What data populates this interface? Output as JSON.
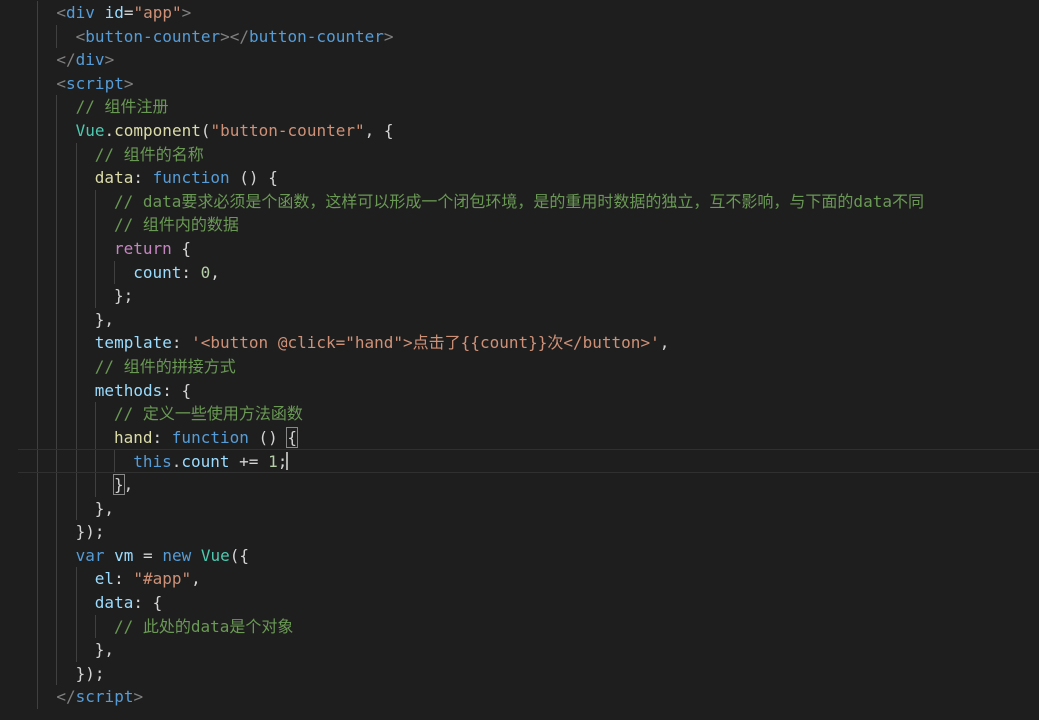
{
  "editor": {
    "language": "html",
    "theme_colors": {
      "background": "#1e1e1e",
      "tag": "#569cd6",
      "attribute": "#9cdcfe",
      "string": "#ce9178",
      "comment": "#6a9955",
      "keyword": "#569cd6",
      "control": "#c586c0",
      "function": "#dcdcaa",
      "class": "#4ec9b0",
      "number": "#b5cea8",
      "text": "#d4d4d4"
    },
    "current_line": 19,
    "lines": [
      {
        "indent": 2,
        "tokens": [
          [
            "t-punct",
            "<"
          ],
          [
            "t-tag",
            "div"
          ],
          [
            "t-text",
            " "
          ],
          [
            "t-attr",
            "id"
          ],
          [
            "t-text",
            "="
          ],
          [
            "t-str",
            "\"app\""
          ],
          [
            "t-punct",
            ">"
          ]
        ]
      },
      {
        "indent": 3,
        "tokens": [
          [
            "t-punct",
            "<"
          ],
          [
            "t-tag",
            "button-counter"
          ],
          [
            "t-punct",
            "></"
          ],
          [
            "t-tag",
            "button-counter"
          ],
          [
            "t-punct",
            ">"
          ]
        ]
      },
      {
        "indent": 2,
        "tokens": [
          [
            "t-punct",
            "</"
          ],
          [
            "t-tag",
            "div"
          ],
          [
            "t-punct",
            ">"
          ]
        ]
      },
      {
        "indent": 2,
        "tokens": [
          [
            "t-punct",
            "<"
          ],
          [
            "t-tag",
            "script"
          ],
          [
            "t-punct",
            ">"
          ]
        ]
      },
      {
        "indent": 3,
        "tokens": [
          [
            "t-cmt",
            "// 组件注册"
          ]
        ]
      },
      {
        "indent": 3,
        "tokens": [
          [
            "t-cls",
            "Vue"
          ],
          [
            "t-text",
            "."
          ],
          [
            "t-fn",
            "component"
          ],
          [
            "t-text",
            "("
          ],
          [
            "t-str",
            "\"button-counter\""
          ],
          [
            "t-text",
            ", {"
          ]
        ]
      },
      {
        "indent": 4,
        "tokens": [
          [
            "t-cmt",
            "// 组件的名称"
          ]
        ]
      },
      {
        "indent": 4,
        "tokens": [
          [
            "t-fn",
            "data"
          ],
          [
            "t-text",
            ": "
          ],
          [
            "t-kw",
            "function"
          ],
          [
            "t-text",
            " () {"
          ]
        ]
      },
      {
        "indent": 5,
        "tokens": [
          [
            "t-cmt",
            "// data要求必须是个函数，这样可以形成一个闭包环境，是的重用时数据的独立，互不影响，与下面的data不同"
          ]
        ]
      },
      {
        "indent": 5,
        "tokens": [
          [
            "t-cmt",
            "// 组件内的数据"
          ]
        ]
      },
      {
        "indent": 5,
        "tokens": [
          [
            "t-ctrl",
            "return"
          ],
          [
            "t-text",
            " {"
          ]
        ]
      },
      {
        "indent": 6,
        "tokens": [
          [
            "t-prop",
            "count"
          ],
          [
            "t-text",
            ": "
          ],
          [
            "t-num",
            "0"
          ],
          [
            "t-text",
            ","
          ]
        ]
      },
      {
        "indent": 5,
        "tokens": [
          [
            "t-text",
            "};"
          ]
        ]
      },
      {
        "indent": 4,
        "tokens": [
          [
            "t-text",
            "},"
          ]
        ]
      },
      {
        "indent": 4,
        "tokens": [
          [
            "t-prop",
            "template"
          ],
          [
            "t-text",
            ": "
          ],
          [
            "t-str",
            "'<button @click=\"hand\">点击了{{count}}次</button>'"
          ],
          [
            "t-text",
            ","
          ]
        ]
      },
      {
        "indent": 4,
        "tokens": [
          [
            "t-cmt",
            "// 组件的拼接方式"
          ]
        ]
      },
      {
        "indent": 4,
        "tokens": [
          [
            "t-prop",
            "methods"
          ],
          [
            "t-text",
            ": {"
          ]
        ]
      },
      {
        "indent": 5,
        "tokens": [
          [
            "t-cmt",
            "// 定义一些使用方法函数"
          ]
        ]
      },
      {
        "indent": 5,
        "tokens": [
          [
            "t-fn",
            "hand"
          ],
          [
            "t-text",
            ": "
          ],
          [
            "t-kw",
            "function"
          ],
          [
            "t-text",
            " () "
          ],
          [
            "t-text t-bracket-match",
            "{"
          ]
        ]
      },
      {
        "indent": 6,
        "tokens": [
          [
            "t-kw",
            "this"
          ],
          [
            "t-text",
            "."
          ],
          [
            "t-prop",
            "count"
          ],
          [
            "t-text",
            " += "
          ],
          [
            "t-num",
            "1"
          ],
          [
            "t-text",
            ";"
          ]
        ]
      },
      {
        "indent": 5,
        "tokens": [
          [
            "t-text t-bracket-match",
            "}"
          ],
          [
            "t-text",
            ","
          ]
        ]
      },
      {
        "indent": 4,
        "tokens": [
          [
            "t-text",
            "},"
          ]
        ]
      },
      {
        "indent": 3,
        "tokens": [
          [
            "t-text",
            "});"
          ]
        ]
      },
      {
        "indent": 3,
        "tokens": [
          [
            "t-kw",
            "var"
          ],
          [
            "t-text",
            " "
          ],
          [
            "t-prop",
            "vm"
          ],
          [
            "t-text",
            " = "
          ],
          [
            "t-kw",
            "new"
          ],
          [
            "t-text",
            " "
          ],
          [
            "t-cls",
            "Vue"
          ],
          [
            "t-text",
            "({"
          ]
        ]
      },
      {
        "indent": 4,
        "tokens": [
          [
            "t-prop",
            "el"
          ],
          [
            "t-text",
            ": "
          ],
          [
            "t-str",
            "\"#app\""
          ],
          [
            "t-text",
            ","
          ]
        ]
      },
      {
        "indent": 4,
        "tokens": [
          [
            "t-prop",
            "data"
          ],
          [
            "t-text",
            ": {"
          ]
        ]
      },
      {
        "indent": 5,
        "tokens": [
          [
            "t-cmt",
            "// 此处的data是个对象"
          ]
        ]
      },
      {
        "indent": 4,
        "tokens": [
          [
            "t-text",
            "},"
          ]
        ]
      },
      {
        "indent": 3,
        "tokens": [
          [
            "t-text",
            "});"
          ]
        ]
      },
      {
        "indent": 2,
        "tokens": [
          [
            "t-punct",
            "</"
          ],
          [
            "t-tag",
            "script"
          ],
          [
            "t-punct",
            ">"
          ]
        ]
      }
    ]
  }
}
